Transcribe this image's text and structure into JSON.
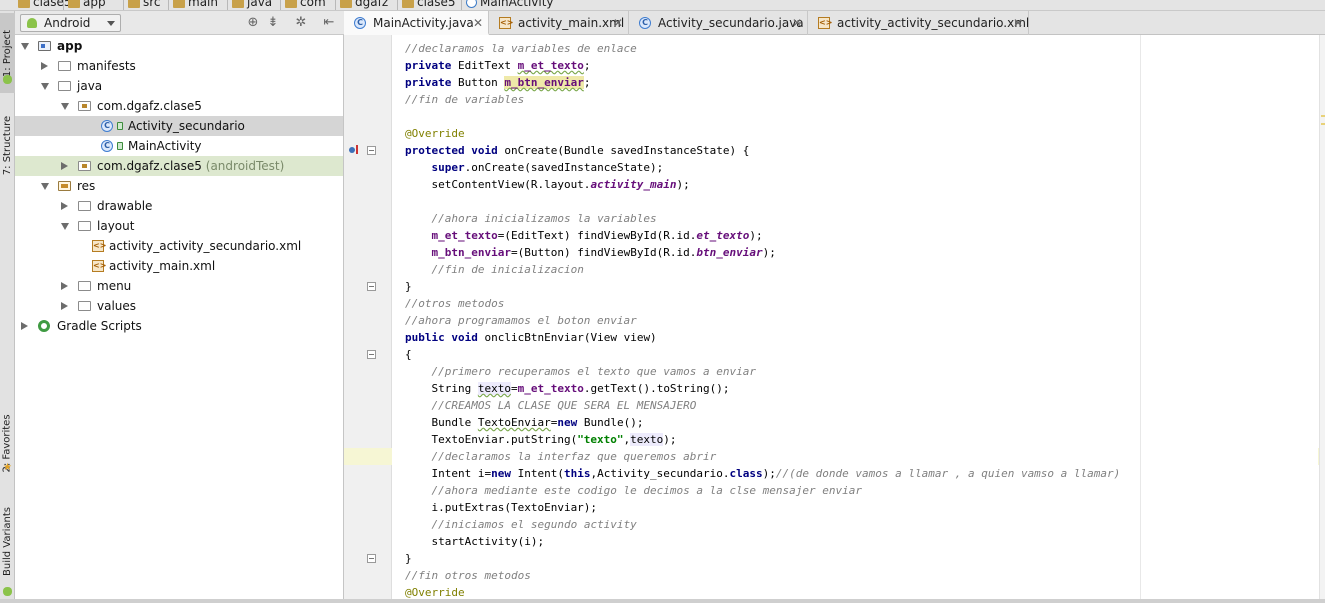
{
  "breadcrumb": [
    "clase5",
    "app",
    "src",
    "main",
    "java",
    "com",
    "dgafz",
    "clase5",
    "MainActivity"
  ],
  "left_tool_windows": {
    "project": "1: Project",
    "structure": "7: Structure",
    "favorites": "2: Favorites",
    "build_variants": "Build Variants"
  },
  "project_view": {
    "selected_view": "Android",
    "tree": [
      {
        "label": "app",
        "icon": "app-module-icon"
      },
      {
        "label": "manifests",
        "icon": "folder-icon"
      },
      {
        "label": "java",
        "icon": "folder-icon"
      },
      {
        "label": "com.dgafz.clase5",
        "icon": "package-icon"
      },
      {
        "label": "Activity_secundario",
        "icon": "java-class-icon"
      },
      {
        "label": "MainActivity",
        "icon": "java-class-icon"
      },
      {
        "label": "com.dgafz.clase5",
        "suffix": "(androidTest)",
        "icon": "package-icon"
      },
      {
        "label": "res",
        "icon": "res-folder-icon"
      },
      {
        "label": "drawable",
        "icon": "folder-icon"
      },
      {
        "label": "layout",
        "icon": "folder-icon"
      },
      {
        "label": "activity_activity_secundario.xml",
        "icon": "xml-file-icon"
      },
      {
        "label": "activity_main.xml",
        "icon": "xml-file-icon"
      },
      {
        "label": "menu",
        "icon": "folder-icon"
      },
      {
        "label": "values",
        "icon": "folder-icon"
      },
      {
        "label": "Gradle Scripts",
        "icon": "gradle-icon"
      }
    ]
  },
  "editor_tabs": [
    {
      "label": "MainActivity.java",
      "icon": "java-class-icon",
      "active": true
    },
    {
      "label": "activity_main.xml",
      "icon": "xml-file-icon",
      "active": false
    },
    {
      "label": "Activity_secundario.java",
      "icon": "java-class-icon",
      "active": false
    },
    {
      "label": "activity_activity_secundario.xml",
      "icon": "xml-file-icon",
      "active": false
    }
  ],
  "code": {
    "lines": [
      "//declaramos la variables de enlace",
      "private EditText m_et_texto;",
      "private Button m_btn_enviar;",
      "//fin de variables",
      "",
      "@Override",
      "protected void onCreate(Bundle savedInstanceState) {",
      "    super.onCreate(savedInstanceState);",
      "    setContentView(R.layout.activity_main);",
      "",
      "    //ahora inicializamos la variables",
      "    m_et_texto=(EditText) findViewById(R.id.et_texto);",
      "    m_btn_enviar=(Button) findViewById(R.id.btn_enviar);",
      "    //fin de inicializacion",
      "}",
      "//otros metodos",
      "//ahora programamos el boton enviar",
      "public void onclicBtnEnviar(View view)",
      "{",
      "    //primero recuperamos el texto que vamos a enviar",
      "    String texto=m_et_texto.getText().toString();",
      "    //CREAMOS LA CLASE QUE SERA EL MENSAJERO",
      "    Bundle TextoEnviar=new Bundle();",
      "    TextoEnviar.putString(\"texto\",texto);",
      "    //declaramos la interfaz que queremos abrir",
      "    Intent i=new Intent(this,Activity_secundario.class);//(de donde vamos a llamar , a quien vamso a llamar)",
      "    //ahora mediante este codigo le decimos a la clse mensajer enviar",
      "    i.putExtras(TextoEnviar);",
      "    //iniciamos el segundo activity",
      "    startActivity(i);",
      "}",
      "//fin otros metodos",
      "@Override"
    ],
    "highlighted_line": 24
  },
  "colors": {
    "keyword": "#000080",
    "comment": "#808080",
    "field": "#660e7a",
    "string": "#008000",
    "annotation": "#808000",
    "current_line": "#f6f6d4",
    "selection": "#d5d5d5",
    "test_package_bg": "#dde8cf"
  }
}
